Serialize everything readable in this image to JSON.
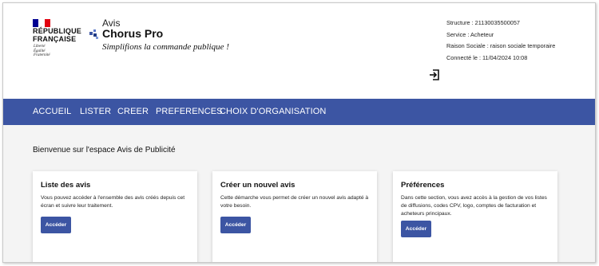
{
  "header": {
    "republic_line1": "RÉPUBLIQUE",
    "republic_line2": "FRANÇAISE",
    "motto1": "Liberté",
    "motto2": "Égalité",
    "motto3": "Fraternité",
    "app_subtitle": "Avis",
    "app_name": "Chorus Pro",
    "slogan": "Simplifions la commande publique !",
    "flag_colors": [
      "#000091",
      "#ffffff",
      "#e1000f"
    ]
  },
  "user_info": {
    "structure": "Structure : 21130035500057",
    "service": "Service : Acheteur",
    "raison_sociale": "Raison Sociale : raison sociale temporaire",
    "connecte": "Connecté le : 11/04/2024 10:08",
    "logout_icon": "logout-icon"
  },
  "nav": {
    "items": [
      "ACCUEIL",
      "LISTER",
      "CREER",
      "PREFERENCES",
      "CHOIX D'ORGANISATION"
    ],
    "color": "#3c55a3"
  },
  "main": {
    "welcome": "Bienvenue sur l'espace Avis de Publicité",
    "cards": [
      {
        "title": "Liste des avis",
        "text": "Vous pouvez accéder à l'ensemble des avis créés depuis cet écran et suivre leur traitement.",
        "button": "Accéder"
      },
      {
        "title": "Créer un nouvel avis",
        "text": "Cette démarche vous permet de créer un nouvel avis adapté à votre besoin.",
        "button": "Accéder"
      },
      {
        "title": "Préférences",
        "text": "Dans cette section, vous avez accès à la gestion de vos listes de diffusions, codes CPV, logo, comptes de facturation et acheteurs principaux.",
        "button": "Accéder"
      }
    ]
  }
}
